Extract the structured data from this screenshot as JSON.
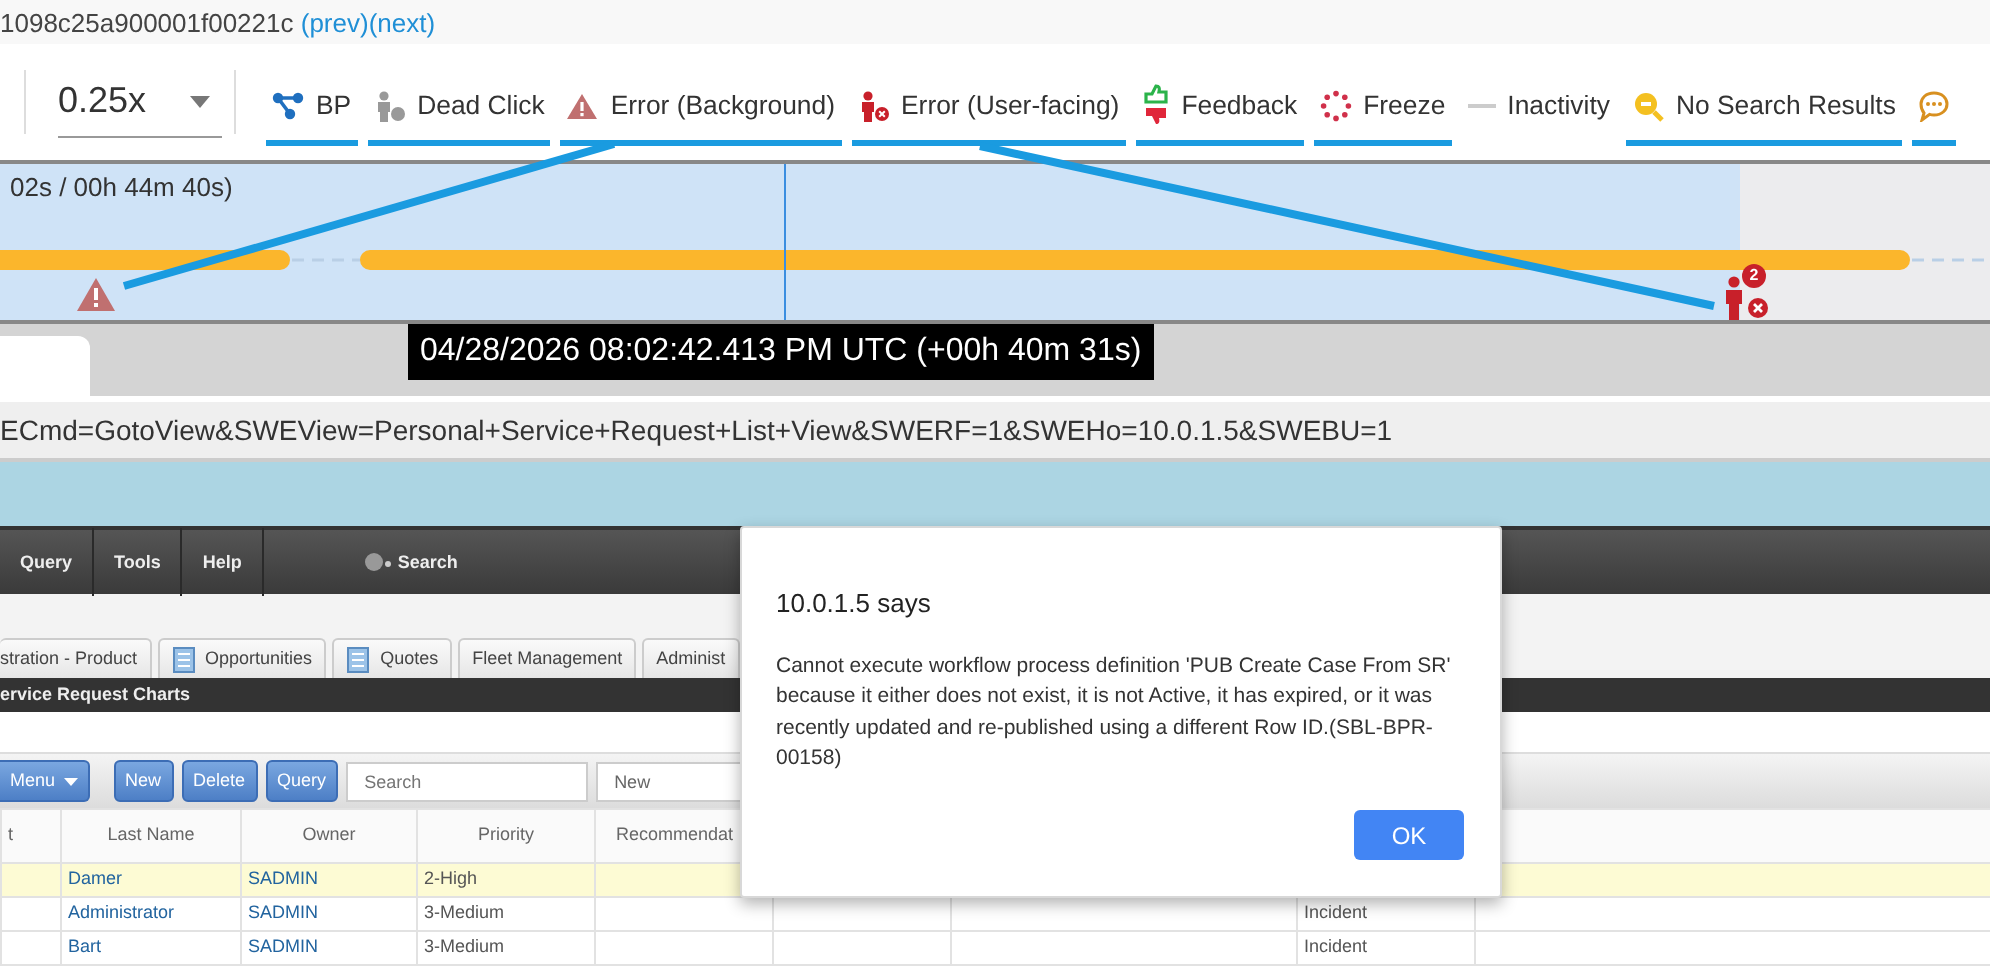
{
  "session": {
    "id": "1098c25a900001f00221c",
    "links": [
      "(prev)",
      "(next)"
    ]
  },
  "speed": {
    "value": "0.25x"
  },
  "filters": [
    {
      "kind": "bp",
      "label": "BP",
      "selected": true
    },
    {
      "kind": "dead-click",
      "label": "Dead Click",
      "selected": true
    },
    {
      "kind": "error-background",
      "label": "Error (Background)",
      "selected": true
    },
    {
      "kind": "error-user",
      "label": "Error (User-facing)",
      "selected": true
    },
    {
      "kind": "feedback",
      "label": "Feedback",
      "selected": true
    },
    {
      "kind": "freeze",
      "label": "Freeze",
      "selected": true
    },
    {
      "kind": "inactivity",
      "label": "Inactivity",
      "selected": false
    },
    {
      "kind": "no-search",
      "label": "No Search Results",
      "selected": true
    },
    {
      "kind": "comment",
      "selected": true
    }
  ],
  "timeline": {
    "elapsed": "02s / 00h 44m 40s)",
    "loaded": {
      "level": 0.874
    },
    "playhead": {
      "level": 0.394
    },
    "markers": [
      {
        "kind": "error-background"
      },
      {
        "kind": "error-user",
        "count": "2"
      }
    ]
  },
  "tooltip": "04/28/2026 08:02:42.413 PM UTC (+00h 40m 31s)",
  "url": "ECmd=GotoView&SWEView=Personal+Service+Request+List+View&SWERF=1&SWEHo=10.0.1.5&SWEBU=1",
  "app": {
    "menu": [
      "Query",
      "Tools",
      "Help"
    ],
    "search_link": "Search",
    "tabs": [
      {
        "label": "stration - Product",
        "icon": false
      },
      {
        "label": "Opportunities",
        "icon": true
      },
      {
        "label": "Quotes",
        "icon": true
      },
      {
        "label": "Fleet Management",
        "icon": false
      },
      {
        "label": "Administ",
        "icon": false
      }
    ],
    "view_title": "ervice Request Charts",
    "buttons": [
      {
        "kind": "menu",
        "label": "Menu"
      },
      {
        "kind": "plain",
        "label": "New"
      },
      {
        "kind": "plain",
        "label": "Delete"
      },
      {
        "kind": "plain",
        "label": "Query"
      }
    ],
    "search": {
      "placeholder": "Search"
    },
    "select": {
      "value": "New"
    },
    "columns": [
      "t",
      "Last Name",
      "Owner",
      "Priority",
      "Recommendat"
    ],
    "rows": [
      {
        "last_name": "Damer",
        "owner": "SADMIN",
        "priority": "2-High",
        "selected": true
      },
      {
        "last_name": "Administrator",
        "owner": "SADMIN",
        "priority": "3-Medium",
        "type": "Incident",
        "selected": false
      },
      {
        "last_name": "Bart",
        "owner": "SADMIN",
        "priority": "3-Medium",
        "type": "Incident",
        "selected": false
      }
    ]
  },
  "dialog": {
    "title": "10.0.1.5 says",
    "message": "Cannot execute workflow process definition 'PUB Create Case From SR' because it either does not exist, it is not Active, it has expired, or it was recently updated and re-published using a different Row ID.(SBL-BPR-00158)",
    "button": "OK"
  }
}
